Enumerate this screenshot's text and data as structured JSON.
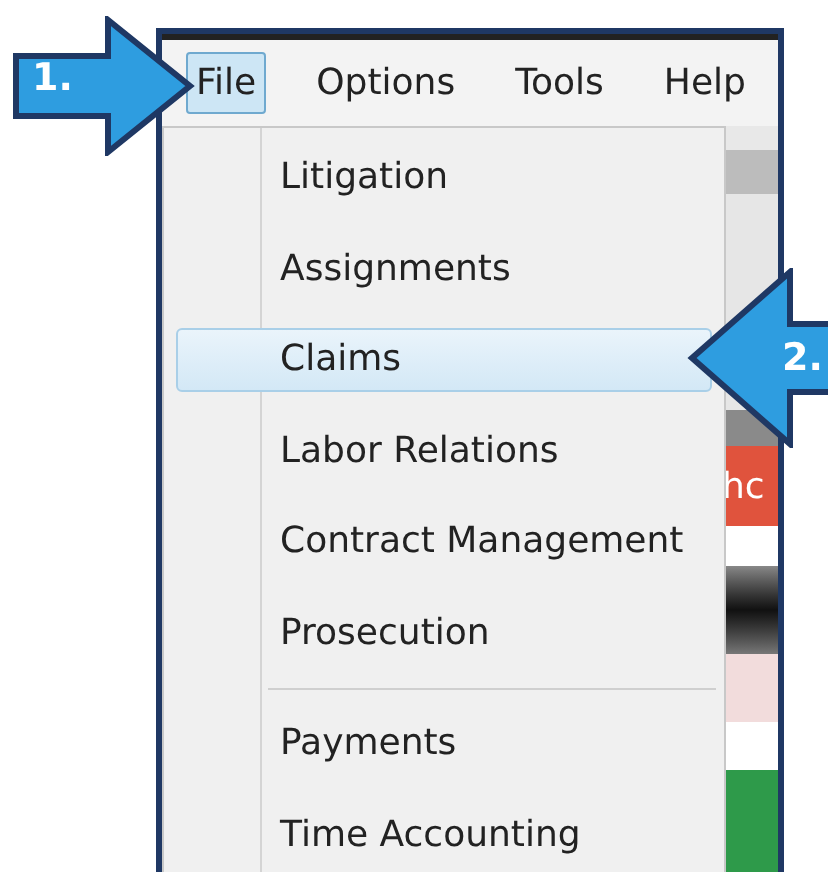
{
  "menu_bar": [
    {
      "label": "File",
      "selected": true
    },
    {
      "label": "Options",
      "selected": false
    },
    {
      "label": "Tools",
      "selected": false
    },
    {
      "label": "Help",
      "selected": false
    }
  ],
  "dropdown": [
    {
      "kind": "item",
      "label": "Litigation",
      "selected": false
    },
    {
      "kind": "item",
      "label": "Assignments",
      "selected": false
    },
    {
      "kind": "item",
      "label": "Claims",
      "selected": true
    },
    {
      "kind": "item",
      "label": "Labor Relations",
      "selected": false
    },
    {
      "kind": "item",
      "label": "Contract Management",
      "selected": false
    },
    {
      "kind": "item",
      "label": "Prosecution",
      "selected": false
    },
    {
      "kind": "separator"
    },
    {
      "kind": "item",
      "label": "Payments",
      "selected": false
    },
    {
      "kind": "item",
      "label": "Time Accounting",
      "selected": false
    }
  ],
  "background_text": "hc",
  "callouts": [
    {
      "label": "1.",
      "kind": "right"
    },
    {
      "label": "2.",
      "kind": "left"
    }
  ]
}
